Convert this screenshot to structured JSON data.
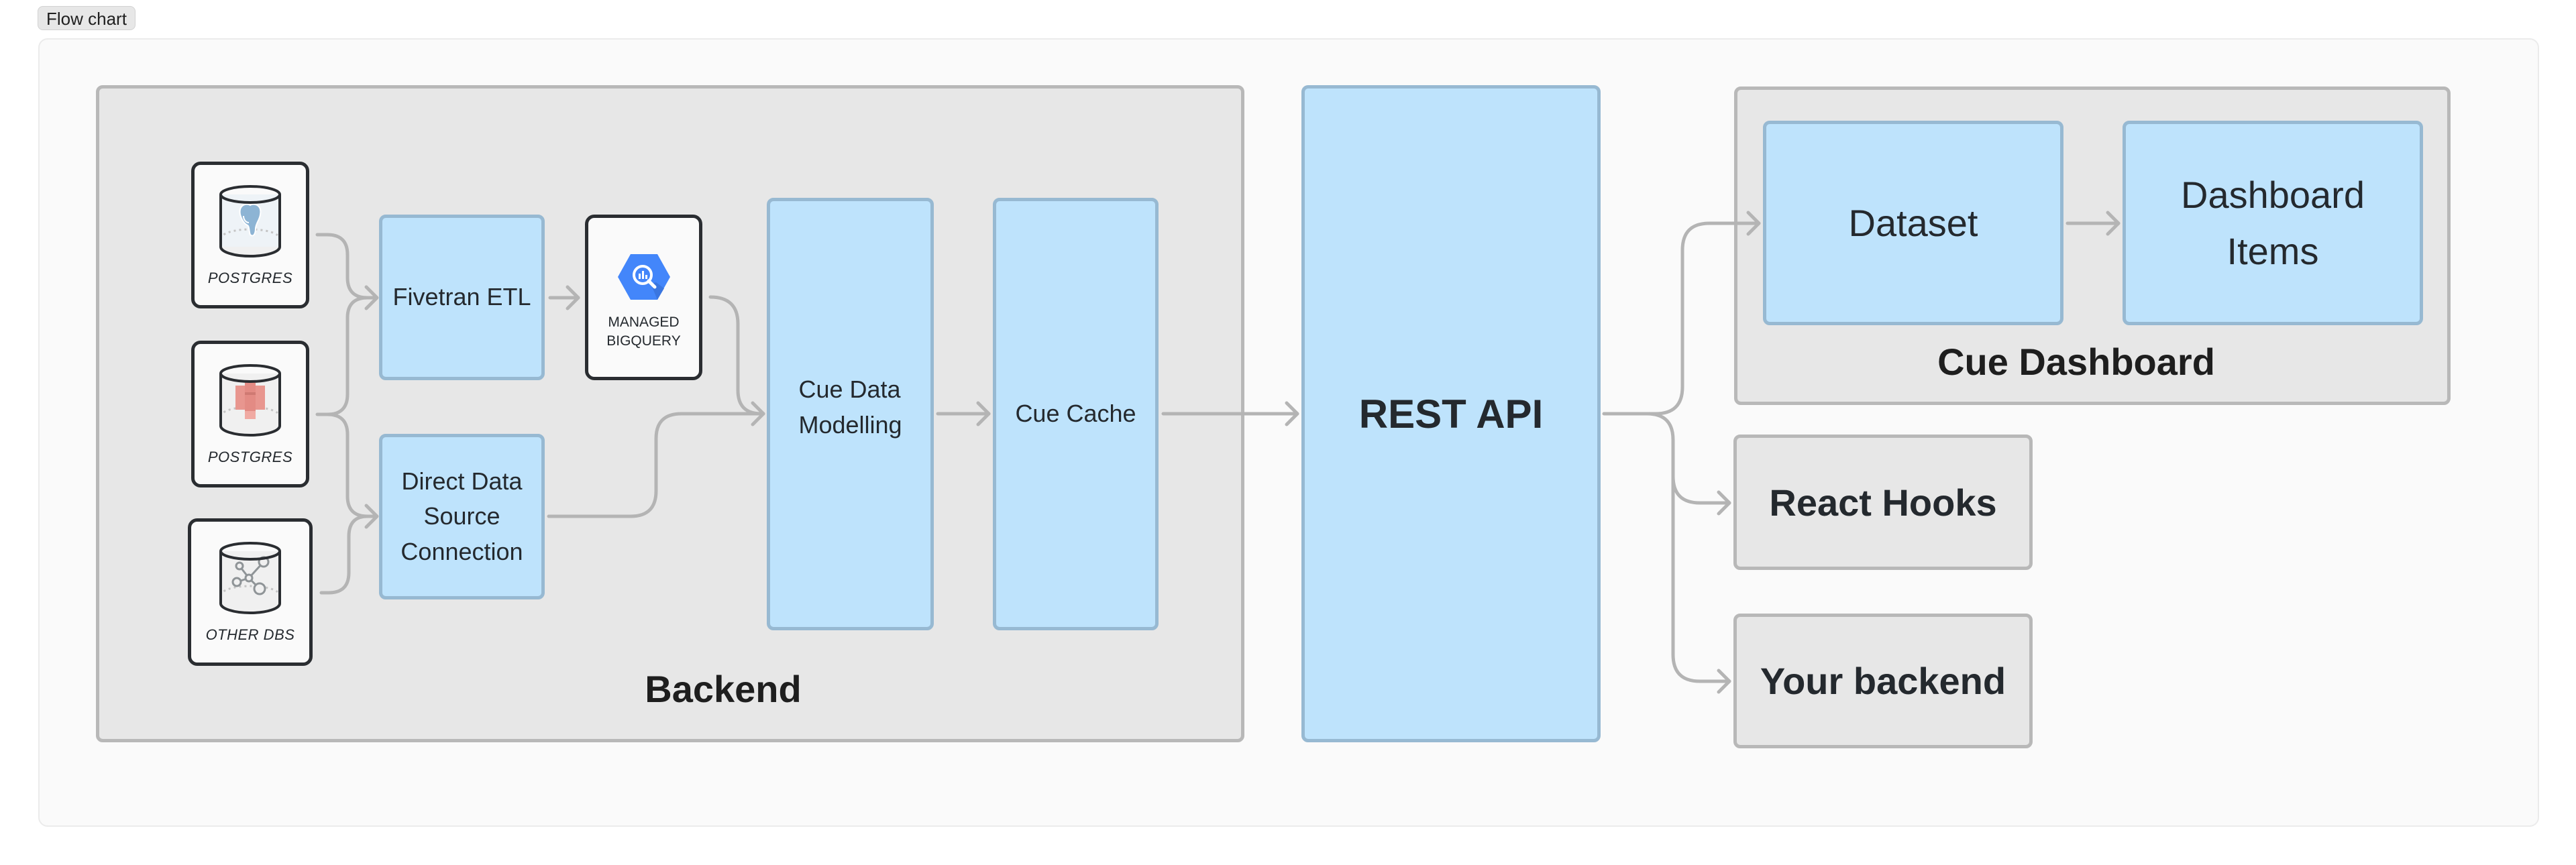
{
  "tab": {
    "label": "Flow chart"
  },
  "backend": {
    "title": "Backend",
    "sources": [
      {
        "label": "POSTGRES",
        "icon": "postgres-elephant-icon"
      },
      {
        "label": "POSTGRES",
        "icon": "aws-redshift-icon"
      },
      {
        "label": "OTHER DBS",
        "icon": "graph-network-icon"
      }
    ],
    "fivetran": {
      "label": "Fivetran ETL"
    },
    "direct": {
      "label": "Direct Data\nSource\nConnection"
    },
    "bigquery": {
      "label": "MANAGED\nBIGQUERY",
      "icon": "bigquery-icon"
    },
    "modelling": {
      "label": "Cue Data\nModelling"
    },
    "cache": {
      "label": "Cue Cache"
    }
  },
  "rest_api": {
    "label": "REST API"
  },
  "dashboard": {
    "title": "Cue Dashboard",
    "dataset": {
      "label": "Dataset"
    },
    "items": {
      "label": "Dashboard\nItems"
    }
  },
  "react_hooks": {
    "label": "React Hooks"
  },
  "your_backend": {
    "label": "Your backend"
  },
  "colors": {
    "node_fill": "#bee3fc",
    "node_border": "#97b9d2",
    "group_fill": "#e7e7e7",
    "group_border": "#b8b8b8",
    "connector": "#b4b4b4",
    "bigquery_blue": "#4386fa",
    "postgres_blue": "#8db4d4",
    "redshift_red": "#e8968f"
  },
  "edges": [
    [
      "postgres-1",
      "fivetran-etl"
    ],
    [
      "postgres-2",
      "fivetran-etl"
    ],
    [
      "postgres-2",
      "direct-data-source-connection"
    ],
    [
      "other-dbs",
      "direct-data-source-connection"
    ],
    [
      "fivetran-etl",
      "managed-bigquery"
    ],
    [
      "managed-bigquery",
      "cue-data-modelling"
    ],
    [
      "direct-data-source-connection",
      "cue-data-modelling"
    ],
    [
      "cue-data-modelling",
      "cue-cache"
    ],
    [
      "cue-cache",
      "rest-api"
    ],
    [
      "rest-api",
      "dataset"
    ],
    [
      "rest-api",
      "react-hooks"
    ],
    [
      "rest-api",
      "your-backend"
    ],
    [
      "dataset",
      "dashboard-items"
    ]
  ]
}
